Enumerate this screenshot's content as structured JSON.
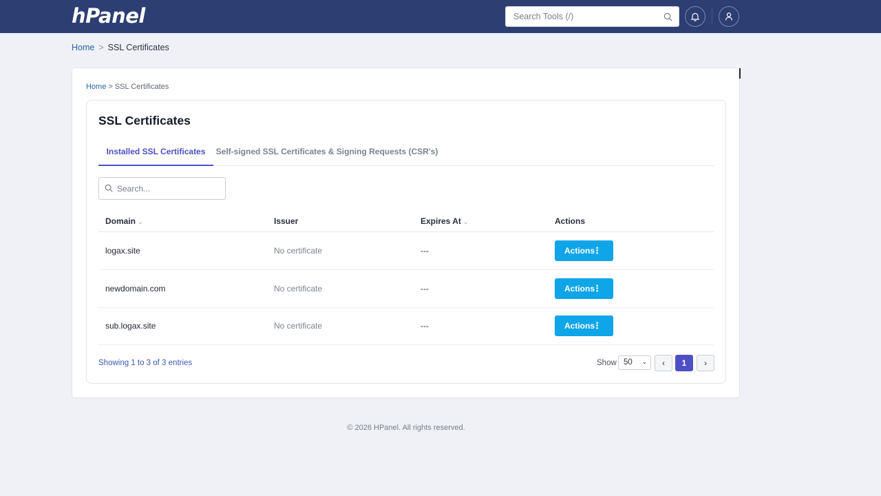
{
  "header": {
    "logo": "hPanel",
    "search_placeholder": "Search Tools (/)"
  },
  "breadcrumb_outer": {
    "home": "Home",
    "sep": ">",
    "current": "SSL Certificates"
  },
  "breadcrumb_inner": {
    "home": "Home",
    "sep": ">",
    "current": "SSL Certificates"
  },
  "page": {
    "title": "SSL Certificates",
    "tabs": [
      {
        "label": "Installed SSL Certificates",
        "active": true
      },
      {
        "label": "Self-signed SSL Certificates & Signing Requests (CSR's)",
        "active": false
      }
    ],
    "search_placeholder": "Search..."
  },
  "table": {
    "headers": [
      "Domain",
      "Issuer",
      "Expires At",
      "Actions"
    ],
    "rows": [
      {
        "domain": "logax.site",
        "issuer": "No certificate",
        "expires": "---",
        "action": "Actions"
      },
      {
        "domain": "newdomain.com",
        "issuer": "No certificate",
        "expires": "---",
        "action": "Actions"
      },
      {
        "domain": "sub.logax.site",
        "issuer": "No certificate",
        "expires": "---",
        "action": "Actions"
      }
    ]
  },
  "pagination": {
    "showing": "Showing 1 to 3 of 3 entries",
    "show_label": "Show",
    "page_size": "50",
    "current_page": "1"
  },
  "footer": "© 2026 HPanel. All rights reserved.",
  "colors": {
    "topbar": "#2c3e72",
    "accent": "#4e4fc4",
    "action_button": "#0ea5e9"
  }
}
